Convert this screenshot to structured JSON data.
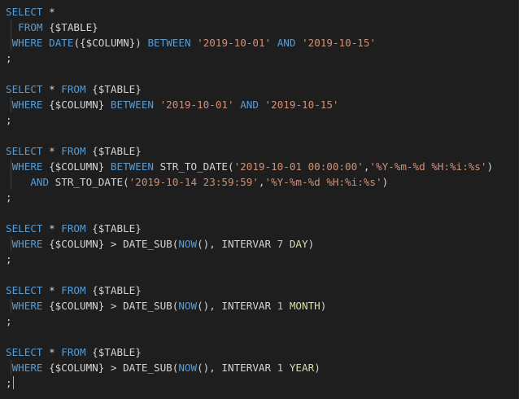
{
  "editor": {
    "colors": {
      "background": "#1e1e1e",
      "keyword": "#569cd6",
      "string": "#ce9178",
      "number": "#b5cea8",
      "text": "#d4d4d4"
    },
    "lines": [
      [
        {
          "t": "SELECT",
          "k": "kw"
        },
        {
          "t": " *",
          "k": "txt"
        }
      ],
      [
        {
          "t": "  ",
          "k": "txt"
        },
        {
          "t": "FROM",
          "k": "kw"
        },
        {
          "t": " {$TABLE}",
          "k": "txt"
        }
      ],
      [
        {
          "t": " ",
          "k": "txt"
        },
        {
          "t": "WHERE",
          "k": "kw"
        },
        {
          "t": " ",
          "k": "txt"
        },
        {
          "t": "DATE",
          "k": "kw"
        },
        {
          "t": "({$COLUMN}) ",
          "k": "txt"
        },
        {
          "t": "BETWEEN",
          "k": "kw"
        },
        {
          "t": " ",
          "k": "txt"
        },
        {
          "t": "'2019-10-01'",
          "k": "str"
        },
        {
          "t": " ",
          "k": "txt"
        },
        {
          "t": "AND",
          "k": "kw"
        },
        {
          "t": " ",
          "k": "txt"
        },
        {
          "t": "'2019-10-15'",
          "k": "str"
        }
      ],
      [
        {
          "t": ";",
          "k": "txt"
        }
      ],
      [],
      [
        {
          "t": "SELECT",
          "k": "kw"
        },
        {
          "t": " * ",
          "k": "txt"
        },
        {
          "t": "FROM",
          "k": "kw"
        },
        {
          "t": " {$TABLE}",
          "k": "txt"
        }
      ],
      [
        {
          "t": " ",
          "k": "txt"
        },
        {
          "t": "WHERE",
          "k": "kw"
        },
        {
          "t": " {$COLUMN} ",
          "k": "txt"
        },
        {
          "t": "BETWEEN",
          "k": "kw"
        },
        {
          "t": " ",
          "k": "txt"
        },
        {
          "t": "'2019-10-01'",
          "k": "str"
        },
        {
          "t": " ",
          "k": "txt"
        },
        {
          "t": "AND",
          "k": "kw"
        },
        {
          "t": " ",
          "k": "txt"
        },
        {
          "t": "'2019-10-15'",
          "k": "str"
        }
      ],
      [
        {
          "t": ";",
          "k": "txt"
        }
      ],
      [],
      [
        {
          "t": "SELECT",
          "k": "kw"
        },
        {
          "t": " * ",
          "k": "txt"
        },
        {
          "t": "FROM",
          "k": "kw"
        },
        {
          "t": " {$TABLE}",
          "k": "txt"
        }
      ],
      [
        {
          "t": " ",
          "k": "txt"
        },
        {
          "t": "WHERE",
          "k": "kw"
        },
        {
          "t": " {$COLUMN} ",
          "k": "txt"
        },
        {
          "t": "BETWEEN",
          "k": "kw"
        },
        {
          "t": " STR_TO_DATE(",
          "k": "txt"
        },
        {
          "t": "'2019-10-01 00:00:00'",
          "k": "str"
        },
        {
          "t": ",",
          "k": "txt"
        },
        {
          "t": "'%Y-%m-%d %H:%i:%s'",
          "k": "str"
        },
        {
          "t": ")",
          "k": "txt"
        }
      ],
      [
        {
          "t": "    ",
          "k": "txt"
        },
        {
          "t": "AND",
          "k": "kw"
        },
        {
          "t": " STR_TO_DATE(",
          "k": "txt"
        },
        {
          "t": "'2019-10-14 23:59:59'",
          "k": "str"
        },
        {
          "t": ",",
          "k": "txt"
        },
        {
          "t": "'%Y-%m-%d %H:%i:%s'",
          "k": "str"
        },
        {
          "t": ")",
          "k": "txt"
        }
      ],
      [
        {
          "t": ";",
          "k": "txt"
        }
      ],
      [],
      [
        {
          "t": "SELECT",
          "k": "kw"
        },
        {
          "t": " * ",
          "k": "txt"
        },
        {
          "t": "FROM",
          "k": "kw"
        },
        {
          "t": " {$TABLE}",
          "k": "txt"
        }
      ],
      [
        {
          "t": " ",
          "k": "txt"
        },
        {
          "t": "WHERE",
          "k": "kw"
        },
        {
          "t": " {$COLUMN} > DATE_SUB(",
          "k": "txt"
        },
        {
          "t": "NOW",
          "k": "kw"
        },
        {
          "t": "(), INTERVAR ",
          "k": "txt"
        },
        {
          "t": "7",
          "k": "num"
        },
        {
          "t": " ",
          "k": "txt"
        },
        {
          "t": "DAY",
          "k": "fn"
        },
        {
          "t": ")",
          "k": "txt"
        }
      ],
      [
        {
          "t": ";",
          "k": "txt"
        }
      ],
      [],
      [
        {
          "t": "SELECT",
          "k": "kw"
        },
        {
          "t": " * ",
          "k": "txt"
        },
        {
          "t": "FROM",
          "k": "kw"
        },
        {
          "t": " {$TABLE}",
          "k": "txt"
        }
      ],
      [
        {
          "t": " ",
          "k": "txt"
        },
        {
          "t": "WHERE",
          "k": "kw"
        },
        {
          "t": " {$COLUMN} > DATE_SUB(",
          "k": "txt"
        },
        {
          "t": "NOW",
          "k": "kw"
        },
        {
          "t": "(), INTERVAR ",
          "k": "txt"
        },
        {
          "t": "1",
          "k": "num"
        },
        {
          "t": " ",
          "k": "txt"
        },
        {
          "t": "MONTH",
          "k": "fn"
        },
        {
          "t": ")",
          "k": "txt"
        }
      ],
      [
        {
          "t": ";",
          "k": "txt"
        }
      ],
      [],
      [
        {
          "t": "SELECT",
          "k": "kw"
        },
        {
          "t": " * ",
          "k": "txt"
        },
        {
          "t": "FROM",
          "k": "kw"
        },
        {
          "t": " {$TABLE}",
          "k": "txt"
        }
      ],
      [
        {
          "t": " ",
          "k": "txt"
        },
        {
          "t": "WHERE",
          "k": "kw"
        },
        {
          "t": " {$COLUMN} > DATE_SUB(",
          "k": "txt"
        },
        {
          "t": "NOW",
          "k": "kw"
        },
        {
          "t": "(), INTERVAR ",
          "k": "txt"
        },
        {
          "t": "1",
          "k": "num"
        },
        {
          "t": " ",
          "k": "txt"
        },
        {
          "t": "YEAR",
          "k": "fn"
        },
        {
          "t": ")",
          "k": "txt"
        }
      ],
      [
        {
          "t": ";",
          "k": "txt"
        }
      ]
    ],
    "cursor_line": 24
  }
}
